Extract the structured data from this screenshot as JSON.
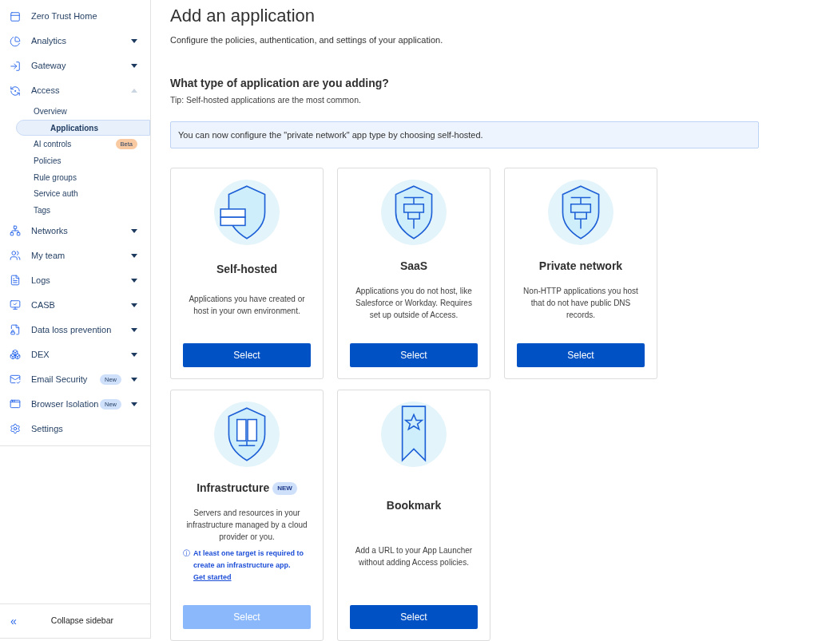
{
  "sidebar": {
    "items": [
      {
        "label": "Zero Trust Home"
      },
      {
        "label": "Analytics",
        "expanded": false
      },
      {
        "label": "Gateway",
        "expanded": false
      },
      {
        "label": "Access",
        "expanded": true,
        "children": [
          {
            "label": "Overview",
            "selected": false
          },
          {
            "label": "Applications",
            "selected": true
          },
          {
            "label": "AI controls",
            "selected": false,
            "badge": {
              "text": "Beta",
              "color": "#f9c9a2"
            }
          },
          {
            "label": "Policies",
            "selected": false
          },
          {
            "label": "Rule groups",
            "selected": false
          },
          {
            "label": "Service auth",
            "selected": false
          },
          {
            "label": "Tags",
            "selected": false
          }
        ]
      },
      {
        "label": "Networks",
        "expanded": false
      },
      {
        "label": "My team",
        "expanded": false
      },
      {
        "label": "Logs",
        "expanded": false
      },
      {
        "label": "CASB",
        "expanded": false
      },
      {
        "label": "Data loss prevention",
        "expanded": false
      },
      {
        "label": "DEX",
        "expanded": false
      },
      {
        "label": "Email Security",
        "expanded": false,
        "badge": {
          "text": "New",
          "color": "#cfe0fb"
        }
      },
      {
        "label": "Browser Isolation",
        "expanded": false,
        "badge": {
          "text": "New",
          "color": "#cfe0fb"
        }
      },
      {
        "label": "Settings"
      }
    ],
    "collapse": {
      "label": "Collapse sidebar",
      "icon": "«"
    }
  },
  "page": {
    "title": "Add an application",
    "subtitle": "Configure the policies, authentication, and settings of your application.",
    "question": "What type of application are you adding?",
    "tip": "Tip: Self-hosted applications are the most common.",
    "notice": "You can now configure the \"private network\" app type by choosing self-hosted."
  },
  "cards": [
    {
      "kind": "self-hosted",
      "title": "Self-hosted",
      "description": "Applications you have created or host in your own environment.",
      "button": {
        "label": "Select",
        "disabled": false
      }
    },
    {
      "kind": "saas",
      "title": "SaaS",
      "description": "Applications you do not host, like Salesforce or Workday. Requires set up outside of Access.",
      "button": {
        "label": "Select",
        "disabled": false
      }
    },
    {
      "kind": "private-network",
      "title": "Private network",
      "description": "Non-HTTP applications you host that do not have public DNS records.",
      "button": {
        "label": "Select",
        "disabled": false
      }
    },
    {
      "kind": "infrastructure",
      "title": "Infrastructure",
      "badge": "NEW",
      "description": "Servers and resources in your infrastructure managed by a cloud provider or you.",
      "info": {
        "icon": "ⓘ",
        "text": "At least one target is required to create an infrastructure app.",
        "link": "Get started"
      },
      "button": {
        "label": "Select",
        "disabled": true
      }
    },
    {
      "kind": "bookmark",
      "title": "Bookmark",
      "description": "Add a URL to your App Launcher without adding Access policies.",
      "button": {
        "label": "Select",
        "disabled": false
      }
    }
  ]
}
